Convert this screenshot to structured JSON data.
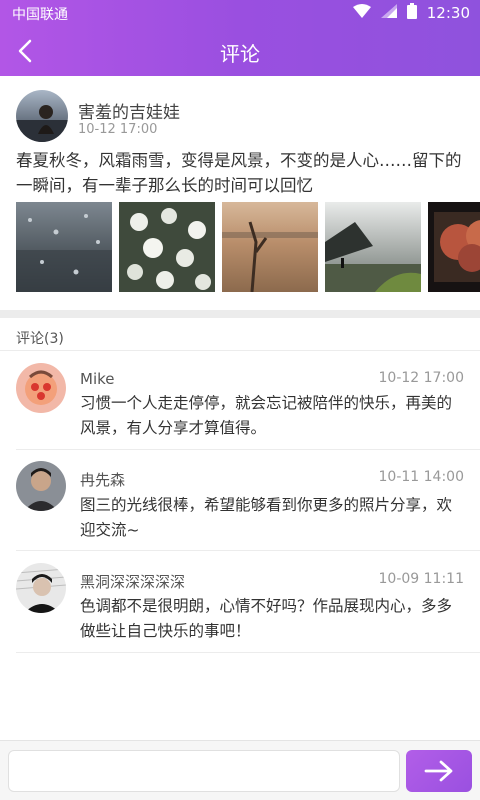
{
  "status_bar": {
    "carrier": "中国联通",
    "time": "12:30"
  },
  "nav": {
    "title": "评论"
  },
  "post": {
    "author": "害羞的吉娃娃",
    "time": "10-12 17:00",
    "text": "春夏秋冬，风霜雨雪，变得是风景，不变的是人心……留下的一瞬间，有一辈子那么长的时间可以回忆",
    "images": [
      "rain-window-photo",
      "white-flowers-photo",
      "lake-branch-photo",
      "coast-photo",
      "autumn-tree-photo"
    ]
  },
  "comments_header": "评论(3)",
  "comments": [
    {
      "name": "Mike",
      "time": "10-12 17:00",
      "text": "习惯一个人走走停停，就会忘记被陪伴的快乐，再美的风景，有人分享才算值得。"
    },
    {
      "name": "冉先森",
      "time": "10-11 14:00",
      "text": "图三的光线很棒，希望能够看到你更多的照片分享，欢迎交流~"
    },
    {
      "name": "黑洞深深深深深",
      "time": "10-09 11:11",
      "text": "色调都不是很明朗，心情不好吗？作品展现内心，多多做些让自己快乐的事吧！"
    }
  ],
  "input": {
    "value": "",
    "placeholder": ""
  },
  "colors": {
    "accent": "#9b51e0",
    "divider": "#ececec"
  }
}
